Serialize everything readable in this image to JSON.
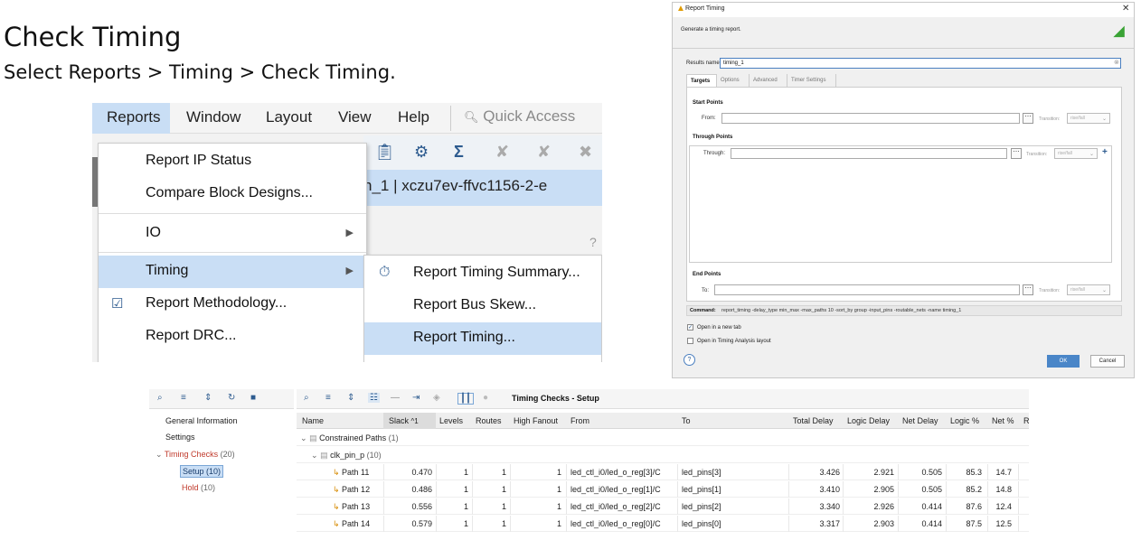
{
  "slide": {
    "title": "Check Timing",
    "instruction": "Select Reports > Timing > Check Timing."
  },
  "menu_screenshot": {
    "menubar": [
      "Reports",
      "Window",
      "Layout",
      "View",
      "Help"
    ],
    "quick_access_placeholder": "Quick Access",
    "project_text": "h_1 | xczu7ev-ffvc1156-2-e",
    "menu_items": [
      {
        "label": "Report IP Status",
        "icon": ""
      },
      {
        "label": "Compare Block Designs...",
        "icon": ""
      },
      {
        "label": "IO",
        "icon": "",
        "submenu": true
      },
      {
        "label": "Timing",
        "icon": "",
        "submenu": true
      },
      {
        "label": "Report Methodology...",
        "icon": "clipboard-check-icon"
      },
      {
        "label": "Report DRC...",
        "icon": ""
      }
    ],
    "submenu_items": [
      {
        "label": "Report Timing Summary...",
        "icon": "stopwatch-icon"
      },
      {
        "label": "Report Bus Skew...",
        "icon": ""
      },
      {
        "label": "Report Timing...",
        "icon": ""
      }
    ]
  },
  "dialog": {
    "title": "Report Timing",
    "description": "Generate a timing report.",
    "results_name_label": "Results name:",
    "results_name_value": "timing_1",
    "tabs": [
      "Targets",
      "Options",
      "Advanced",
      "Timer Settings"
    ],
    "start_points_title": "Start Points",
    "from_label": "From:",
    "through_points_title": "Through Points",
    "through_label": "Through:",
    "end_points_title": "End Points",
    "to_label": "To:",
    "transition_label": "Transition:",
    "transition_value": "rise/fall",
    "command_label": "Command:",
    "command_text": "report_timing -delay_type min_max -max_paths 10 -sort_by group -input_pins -routable_nets -name timing_1",
    "open_new_tab_label": "Open in a new tab",
    "open_new_tab_checked": true,
    "open_timing_layout_label": "Open in Timing Analysis layout",
    "open_timing_layout_checked": false,
    "help_label": "?",
    "ok_label": "OK",
    "cancel_label": "Cancel"
  },
  "timing_checks": {
    "section_title": "Timing Checks - Setup",
    "tree": {
      "general_information": "General Information",
      "settings": "Settings",
      "timing_checks_label": "Timing Checks",
      "timing_checks_count": "(20)",
      "setup_label": "Setup (10)",
      "hold_label": "Hold",
      "hold_count": "(10)"
    },
    "columns": [
      "Name",
      "Slack",
      "Levels",
      "Routes",
      "High Fanout",
      "From",
      "To",
      "Total Delay",
      "Logic Delay",
      "Net Delay",
      "Logic %",
      "Net %",
      "R"
    ],
    "slack_sort_indicator": "^1",
    "group_label": "Constrained Paths",
    "group_count": "(1)",
    "clock_label": "clk_pin_p",
    "clock_count": "(10)",
    "rows": [
      {
        "name": "Path 11",
        "slack": "0.470",
        "levels": "1",
        "routes": "1",
        "high_fanout": "1",
        "from": "led_ctl_i0/led_o_reg[3]/C",
        "to": "led_pins[3]",
        "total_delay": "3.426",
        "logic_delay": "2.921",
        "net_delay": "0.505",
        "logic_pct": "85.3",
        "net_pct": "14.7"
      },
      {
        "name": "Path 12",
        "slack": "0.486",
        "levels": "1",
        "routes": "1",
        "high_fanout": "1",
        "from": "led_ctl_i0/led_o_reg[1]/C",
        "to": "led_pins[1]",
        "total_delay": "3.410",
        "logic_delay": "2.905",
        "net_delay": "0.505",
        "logic_pct": "85.2",
        "net_pct": "14.8"
      },
      {
        "name": "Path 13",
        "slack": "0.556",
        "levels": "1",
        "routes": "1",
        "high_fanout": "1",
        "from": "led_ctl_i0/led_o_reg[2]/C",
        "to": "led_pins[2]",
        "total_delay": "3.340",
        "logic_delay": "2.926",
        "net_delay": "0.414",
        "logic_pct": "87.6",
        "net_pct": "12.4"
      },
      {
        "name": "Path 14",
        "slack": "0.579",
        "levels": "1",
        "routes": "1",
        "high_fanout": "1",
        "from": "led_ctl_i0/led_o_reg[0]/C",
        "to": "led_pins[0]",
        "total_delay": "3.317",
        "logic_delay": "2.903",
        "net_delay": "0.414",
        "logic_pct": "87.5",
        "net_pct": "12.5"
      }
    ]
  }
}
